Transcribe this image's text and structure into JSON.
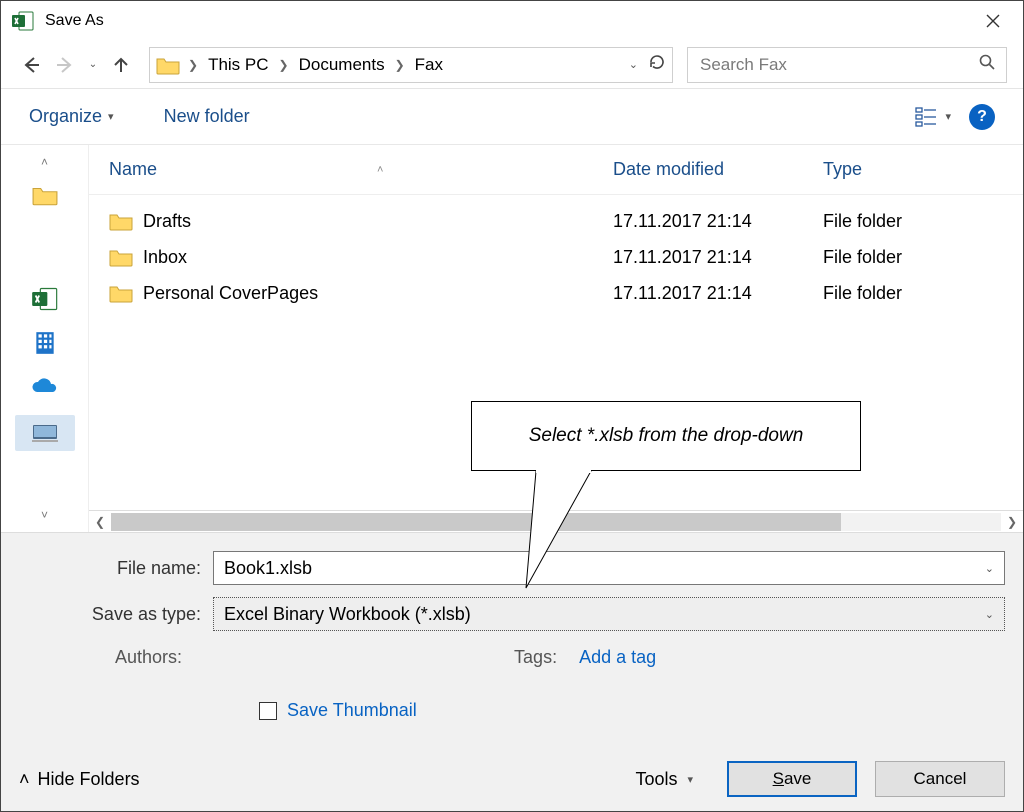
{
  "window": {
    "title": "Save As"
  },
  "nav": {
    "breadcrumbs": [
      "This PC",
      "Documents",
      "Fax"
    ]
  },
  "search": {
    "placeholder": "Search Fax"
  },
  "toolbar": {
    "organize": "Organize",
    "new_folder": "New folder"
  },
  "columns": {
    "name": "Name",
    "date": "Date modified",
    "type": "Type"
  },
  "rows": [
    {
      "name": "Drafts",
      "date": "17.11.2017 21:14",
      "type": "File folder"
    },
    {
      "name": "Inbox",
      "date": "17.11.2017 21:14",
      "type": "File folder"
    },
    {
      "name": "Personal CoverPages",
      "date": "17.11.2017 21:14",
      "type": "File folder"
    }
  ],
  "callout": {
    "text": "Select *.xlsb from the drop-down"
  },
  "form": {
    "file_name_label": "File name:",
    "file_name_value": "Book1.xlsb",
    "type_label": "Save as type:",
    "type_value": "Excel Binary Workbook (*.xlsb)",
    "authors_label": "Authors:",
    "tags_label": "Tags:",
    "tags_link": "Add a tag",
    "thumb_label": "Save Thumbnail"
  },
  "buttons": {
    "hide_folders": "Hide Folders",
    "tools": "Tools",
    "save": "Save",
    "save_ul": "S",
    "save_rest": "ave",
    "cancel": "Cancel"
  }
}
